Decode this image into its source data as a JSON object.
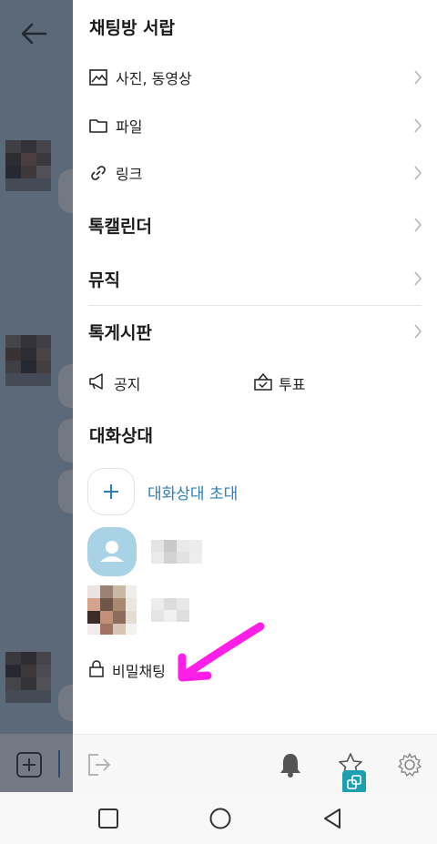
{
  "drawer": {
    "title": "채팅방 서랍",
    "menu": [
      {
        "label": "사진, 동영상",
        "icon": "image-icon"
      },
      {
        "label": "파일",
        "icon": "folder-icon"
      },
      {
        "label": "링크",
        "icon": "link-icon"
      },
      {
        "label": "톡캘린더",
        "icon": ""
      },
      {
        "label": "뮤직",
        "icon": ""
      },
      {
        "label": "톡게시판",
        "icon": ""
      }
    ],
    "quick_actions": [
      {
        "label": "공지",
        "icon": "megaphone-icon"
      },
      {
        "label": "투표",
        "icon": "vote-box-icon"
      }
    ]
  },
  "members_section": {
    "title": "대화상대",
    "invite_label": "대화상대 초대"
  },
  "secret_chat": {
    "label": "비밀채팅",
    "icon": "lock-icon"
  },
  "bottom_bar": {
    "icons": [
      "leave-icon",
      "bell-icon",
      "star-icon",
      "gear-icon"
    ]
  },
  "colors": {
    "accent_blue": "#2e7fb8",
    "annotation_magenta": "#ff1ee8",
    "badge_teal": "#1e9fb0"
  }
}
